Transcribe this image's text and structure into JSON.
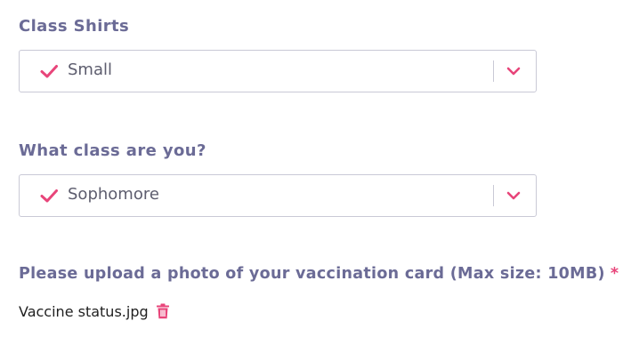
{
  "form": {
    "shirts": {
      "label": "Class Shirts",
      "selected": "Small"
    },
    "class_year": {
      "label": "What class are you?",
      "selected": "Sophomore"
    },
    "vaccination": {
      "label": "Please upload a photo of your vaccination card (Max size: 10MB)",
      "required_mark": "*",
      "file_name": "Vaccine status.jpg"
    }
  },
  "icons": {
    "check": "check-icon",
    "chevron": "chevron-down-icon",
    "delete": "trash-icon"
  },
  "colors": {
    "accent": "#e8457a",
    "label": "#6b6b96",
    "border": "#c9c9d6"
  }
}
